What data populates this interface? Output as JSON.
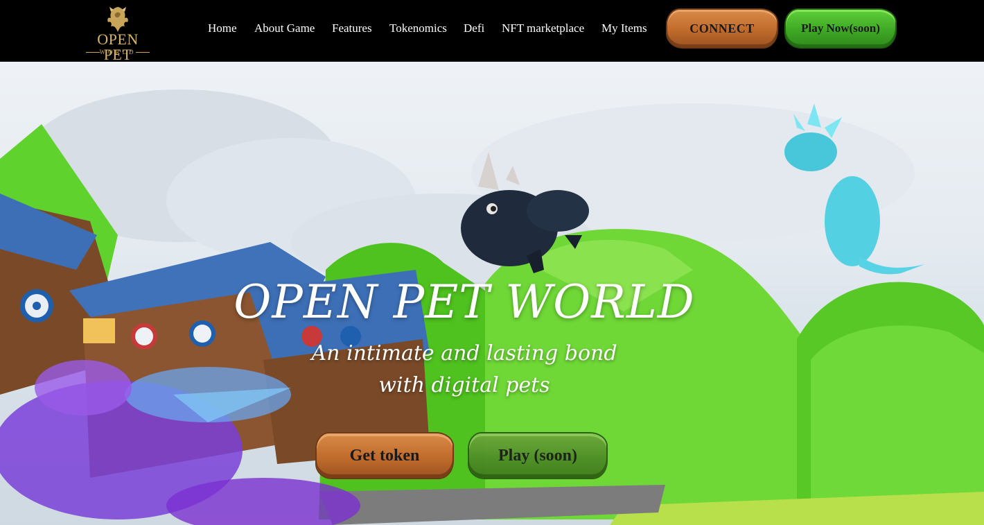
{
  "brand": {
    "logo_line1": "OPEN PET",
    "logo_line2": "WORLD"
  },
  "nav": {
    "items": [
      {
        "label": "Home"
      },
      {
        "label": "About Game"
      },
      {
        "label": "Features"
      },
      {
        "label": "Tokenomics"
      },
      {
        "label": "Defi"
      },
      {
        "label": "NFT marketplace"
      },
      {
        "label": "My Items"
      }
    ],
    "connect_label": "CONNECT",
    "play_now_label": "Play Now(soon)"
  },
  "hero": {
    "title": "OPEN PET WORLD",
    "subtitle_line1": "An intimate and lasting bond",
    "subtitle_line2": "with digital pets",
    "get_token_label": "Get token",
    "play_label": "Play (soon)"
  },
  "colors": {
    "nav_bg": "#000000",
    "gold": "#c9a55a",
    "orange_button": "#c06b2c",
    "green_button": "#3ea824"
  }
}
